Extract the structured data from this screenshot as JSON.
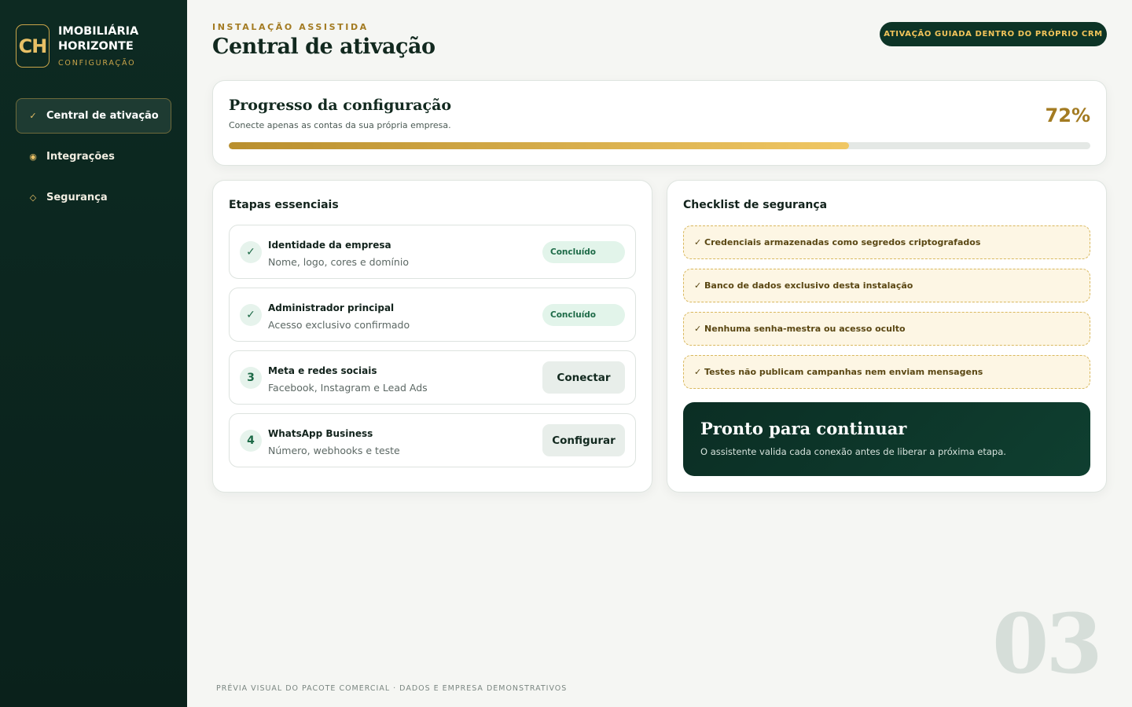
{
  "sidebar": {
    "logo_initials": "CH",
    "brand_name": "IMOBILIÁRIA HORIZONTE",
    "brand_sub": "CONFIGURAÇÃO",
    "items": [
      {
        "icon": "check-icon",
        "glyph": "✓",
        "label": "Central de ativação",
        "active": true
      },
      {
        "icon": "dot-icon",
        "glyph": "◉",
        "label": "Integrações",
        "active": false
      },
      {
        "icon": "diamond-icon",
        "glyph": "◇",
        "label": "Segurança",
        "active": false
      }
    ]
  },
  "header": {
    "eyebrow": "INSTALAÇÃO ASSISTIDA",
    "title": "Central de ativação",
    "badge": "ATIVAÇÃO GUIADA DENTRO DO PRÓPRIO CRM"
  },
  "progress": {
    "title": "Progresso da configuração",
    "subtitle": "Conecte apenas as contas da sua própria empresa.",
    "percent_label": "72%",
    "value": 0.72
  },
  "steps": {
    "heading": "Etapas essenciais",
    "items": [
      {
        "marker": "✓",
        "title": "Identidade da empresa",
        "desc": "Nome, logo, cores e domínio",
        "status": "Concluído"
      },
      {
        "marker": "✓",
        "title": "Administrador principal",
        "desc": "Acesso exclusivo confirmado",
        "status": "Concluído"
      },
      {
        "marker": "3",
        "title": "Meta e redes sociais",
        "desc": "Facebook, Instagram e Lead Ads",
        "action": "Conectar"
      },
      {
        "marker": "4",
        "title": "WhatsApp Business",
        "desc": "Número, webhooks e teste",
        "action": "Configurar"
      }
    ]
  },
  "security": {
    "heading": "Checklist de segurança",
    "items": [
      "✓ Credenciais armazenadas como segredos criptografados",
      "✓ Banco de dados exclusivo desta instalação",
      "✓ Nenhuma senha-mestra ou acesso oculto",
      "✓ Testes não publicam campanhas nem enviam mensagens"
    ],
    "ready_title": "Pronto para continuar",
    "ready_sub": "O assistente valida cada conexão antes de liberar a próxima etapa."
  },
  "watermark": "03",
  "footer": "PRÉVIA VISUAL DO PACOTE COMERCIAL · DADOS E EMPRESA DEMONSTRATIVOS",
  "colors": {
    "sidebar_bg": "#0d2a22",
    "accent_gold": "#a37b22",
    "accent_green": "#1d6a47",
    "dark_green": "#0d3426"
  }
}
